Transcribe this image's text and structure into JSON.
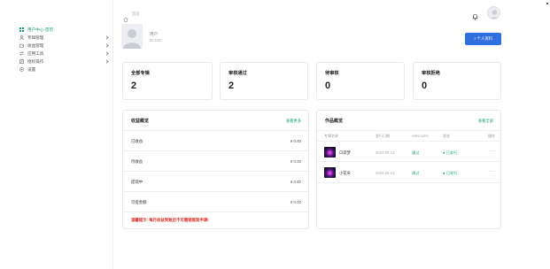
{
  "sidebar": {
    "items": [
      {
        "label": "用户中心-首页",
        "icon": "grid-icon",
        "active": true
      },
      {
        "label": "专辑管理",
        "icon": "user-icon",
        "expandable": true
      },
      {
        "label": "收益管理",
        "icon": "wallet-icon",
        "expandable": true
      },
      {
        "label": "应用工具",
        "icon": "swap-icon",
        "expandable": true
      },
      {
        "label": "授权操作",
        "icon": "edit-icon",
        "expandable": true
      },
      {
        "label": "设置",
        "icon": "settings-icon"
      }
    ]
  },
  "topbar": {
    "breadcrumb": "首页"
  },
  "profile": {
    "name": "用户",
    "id_text": "ID:132",
    "button_label": "+ 个人资料"
  },
  "stats": [
    {
      "label": "全部专辑",
      "value": "2"
    },
    {
      "label": "审核通过",
      "value": "2"
    },
    {
      "label": "待审核",
      "value": "0"
    },
    {
      "label": "审核拒绝",
      "value": "0"
    }
  ],
  "income": {
    "title": "收益概览",
    "link": "查看更多",
    "rows": [
      {
        "label": "已收益",
        "value": "¥ 0.00"
      },
      {
        "label": "待收益",
        "value": "¥ 0.00"
      },
      {
        "label": "提现中",
        "value": "¥ 0.00"
      },
      {
        "label": "可提金额",
        "value": "¥ 0.00"
      }
    ],
    "warning": "温馨提示: 每月收益到账后不可撤销提现申请!"
  },
  "works": {
    "title": "作品概览",
    "link": "查看全部",
    "columns": [
      "专辑名称",
      "发行日期",
      "ISRC/UPC",
      "状态",
      "操作"
    ],
    "rows": [
      {
        "name": "口袋梦",
        "date": "2024-05-13",
        "price": "通过",
        "status": "● 已发行",
        "more": "···"
      },
      {
        "name": "小花朵",
        "date": "2024-05-14",
        "price": "通过",
        "status": "● 已发行",
        "more": "···"
      }
    ]
  },
  "colors": {
    "accent": "#2f6fde",
    "success": "#1a9e6a",
    "danger": "#e0302b"
  }
}
